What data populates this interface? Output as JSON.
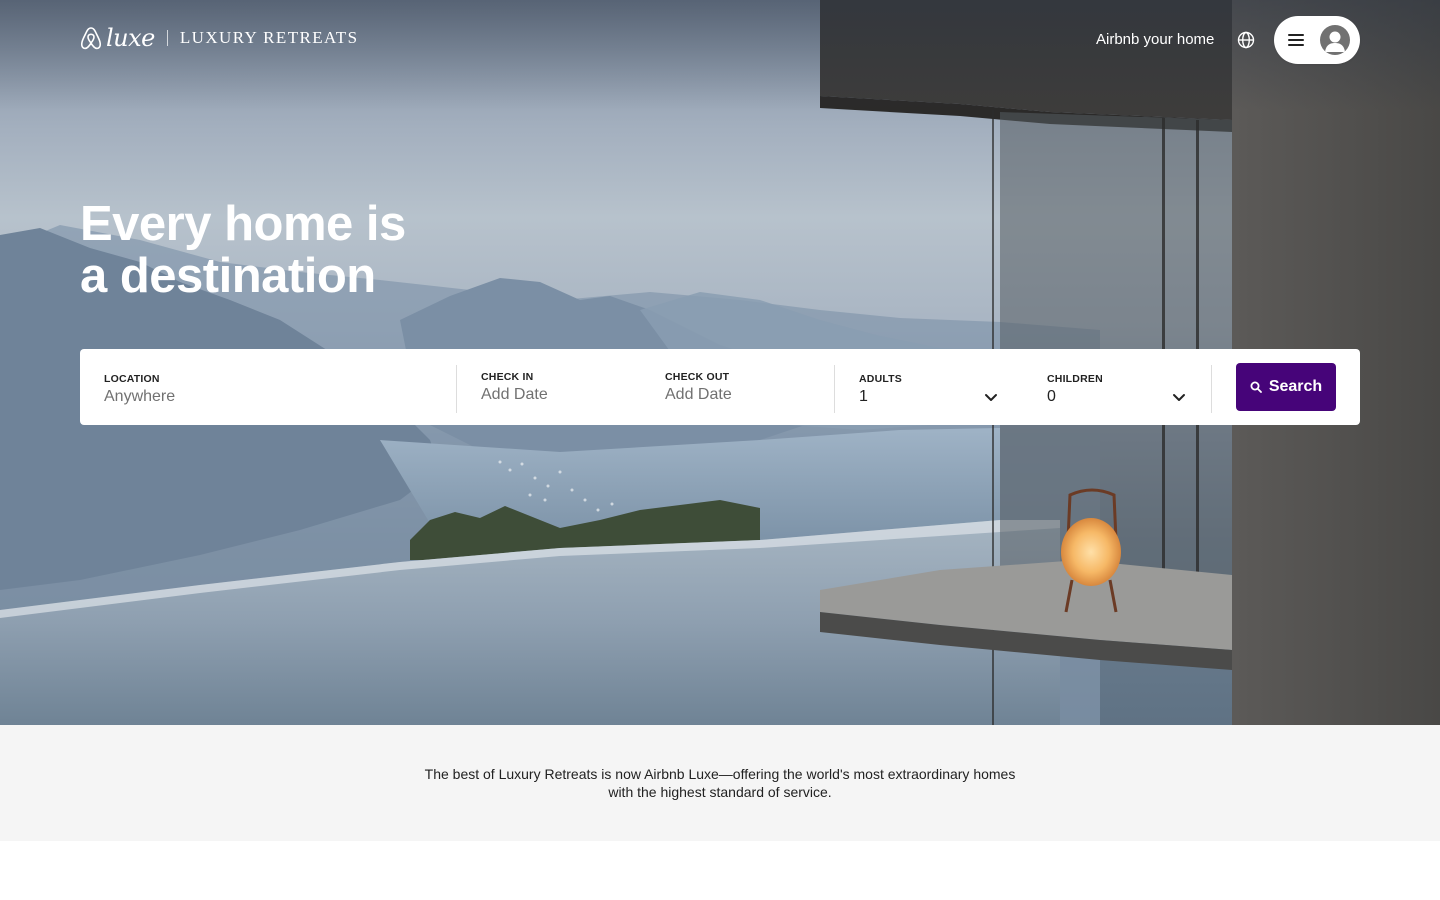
{
  "header": {
    "logo": {
      "brand_icon": "airbnb-belo-icon",
      "luxe_text": "luxe",
      "partner_text": "LUXURY RETREATS"
    },
    "host_link": "Airbnb your home",
    "globe_icon": "globe-icon",
    "menu_icon": "hamburger-icon",
    "avatar_icon": "user-avatar-icon"
  },
  "hero": {
    "headline_line1": "Every home is",
    "headline_line2": "a destination"
  },
  "search": {
    "location": {
      "label": "LOCATION",
      "placeholder": "Anywhere"
    },
    "check_in": {
      "label": "CHECK IN",
      "placeholder": "Add Date"
    },
    "check_out": {
      "label": "CHECK OUT",
      "placeholder": "Add Date"
    },
    "adults": {
      "label": "ADULTS",
      "value": "1"
    },
    "children": {
      "label": "CHILDREN",
      "value": "0"
    },
    "button_label": "Search",
    "button_icon": "search-icon"
  },
  "info": {
    "text": "The best of Luxury Retreats is now Airbnb Luxe—offering the world's most extraordinary homes with the highest standard of service."
  },
  "colors": {
    "accent": "#460479",
    "band_bg": "#f5f5f5",
    "text": "#222222",
    "muted": "#717171"
  }
}
